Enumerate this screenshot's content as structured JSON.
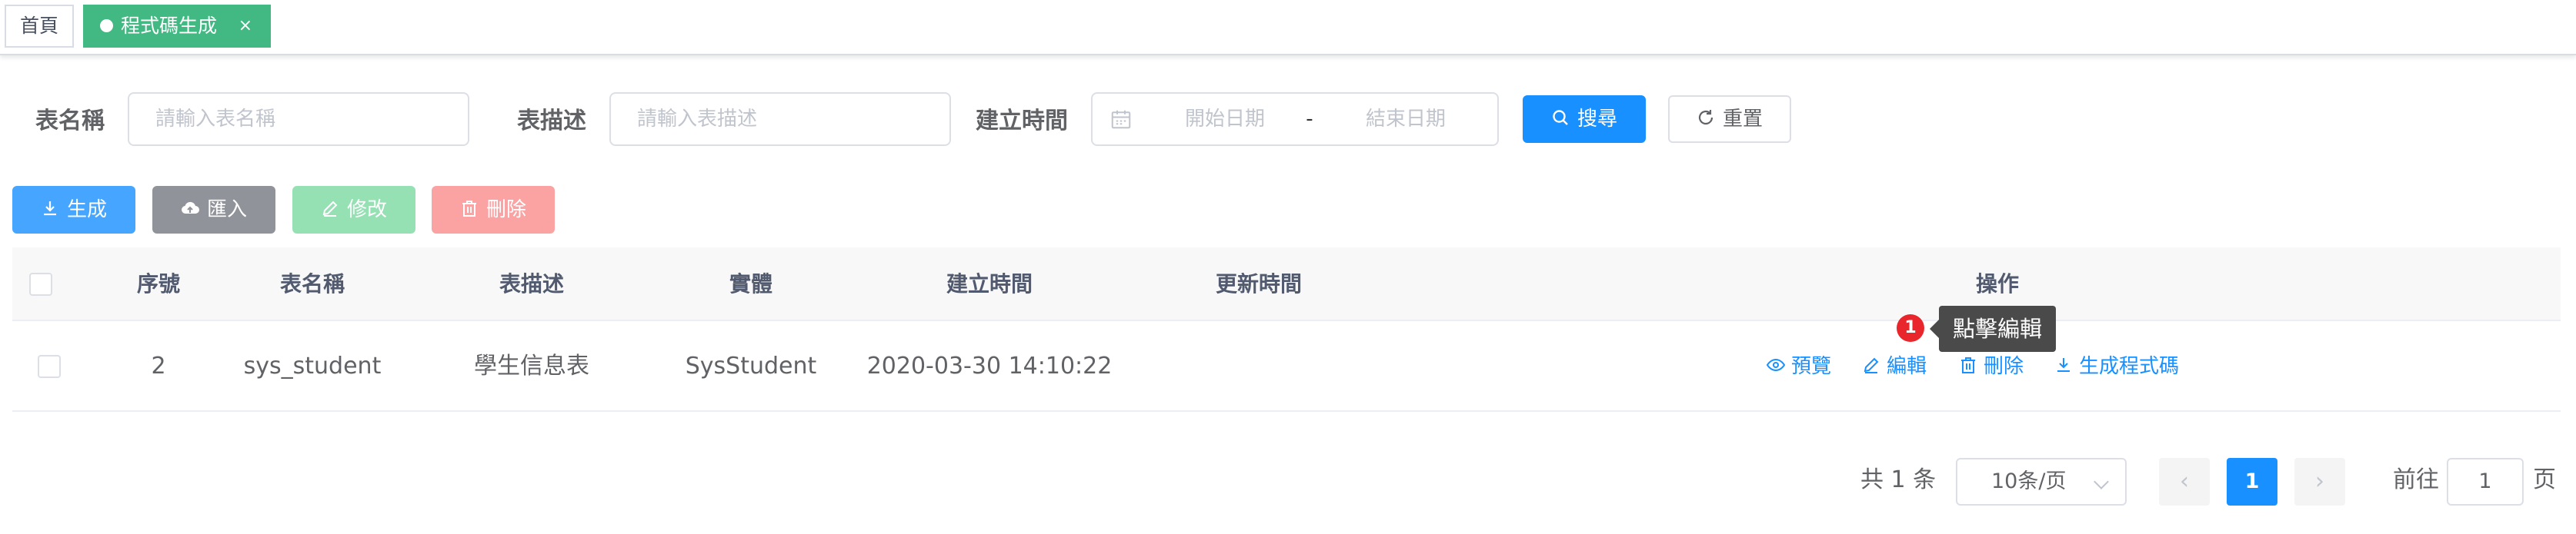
{
  "tags": {
    "home": "首頁",
    "active": "程式碼生成",
    "close_glyph": "×"
  },
  "search": {
    "table_name_label": "表名稱",
    "table_name_placeholder": "請輸入表名稱",
    "table_desc_label": "表描述",
    "table_desc_placeholder": "請輸入表描述",
    "created_label": "建立時間",
    "start_placeholder": "開始日期",
    "range_separator": "-",
    "end_placeholder": "結束日期",
    "search_button": "搜尋",
    "reset_button": "重置"
  },
  "toolbar": {
    "generate": "生成",
    "import": "匯入",
    "edit": "修改",
    "delete": "刪除"
  },
  "table": {
    "headers": {
      "index": "序號",
      "table_name": "表名稱",
      "table_desc": "表描述",
      "entity": "實體",
      "created": "建立時間",
      "updated": "更新時間",
      "actions": "操作"
    },
    "rows": [
      {
        "index": "2",
        "table_name": "sys_student",
        "table_desc": "學生信息表",
        "entity": "SysStudent",
        "created": "2020-03-30 14:10:22",
        "updated": ""
      }
    ],
    "actions": {
      "preview": "預覽",
      "edit": "編輯",
      "delete": "刪除",
      "generate_code": "生成程式碼"
    }
  },
  "tooltip": {
    "step": "1",
    "text": "點擊編輯"
  },
  "pagination": {
    "total": "共 1 条",
    "page_size": "10条/页",
    "prev_glyph": "‹",
    "next_glyph": "›",
    "current_page": "1",
    "goto_label": "前往",
    "goto_value": "1",
    "goto_unit": "页"
  },
  "colors": {
    "primary": "#1890ff",
    "tag_active": "#42b983",
    "tooltip_bg": "#4a4a4a",
    "badge": "#e8262b"
  }
}
